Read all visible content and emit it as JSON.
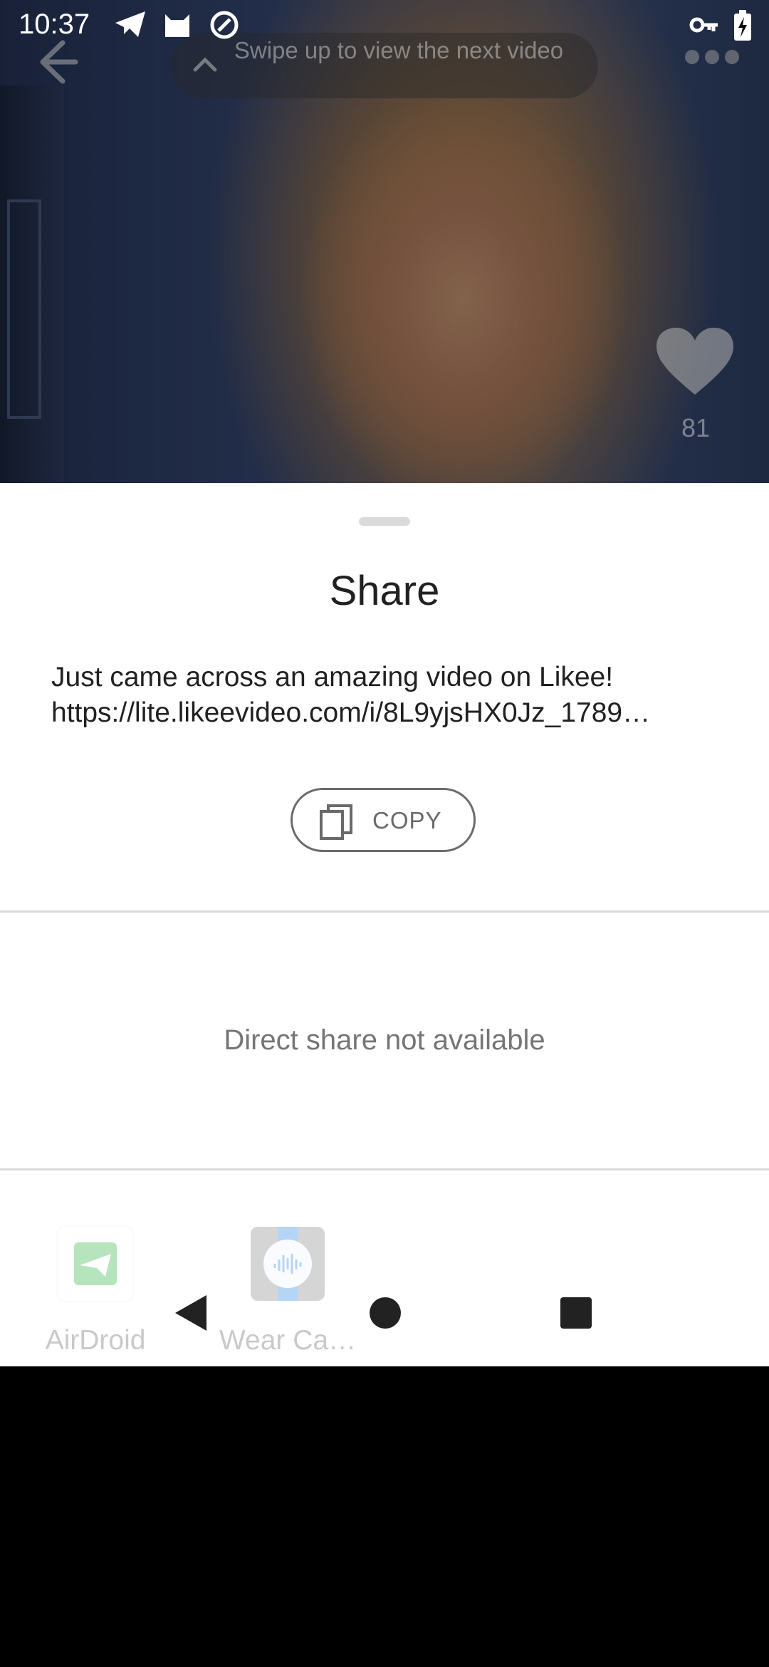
{
  "status_bar": {
    "time": "10:37",
    "icons": [
      "telegram-icon",
      "cat-icon",
      "at-sign-icon",
      "vpn-key-icon",
      "battery-charging-icon"
    ]
  },
  "video": {
    "swipe_hint": "Swipe up to view the next video",
    "like_count": "81"
  },
  "share_sheet": {
    "title": "Share",
    "message_line1": "Just came across an amazing video on Likee!",
    "message_line2": "https://lite.likeevideo.com/i/8L9yjsHX0Jz_1789…",
    "copy_label": "COPY",
    "direct_share_text": "Direct share not available",
    "apps": [
      {
        "label": "AirDroid",
        "icon": "airdroid-icon"
      },
      {
        "label": "Wear Ca…",
        "icon": "wear-casts-icon"
      }
    ]
  },
  "navigation_bar": {
    "icons": [
      "back-triangle-icon",
      "home-circle-icon",
      "recents-square-icon"
    ]
  }
}
